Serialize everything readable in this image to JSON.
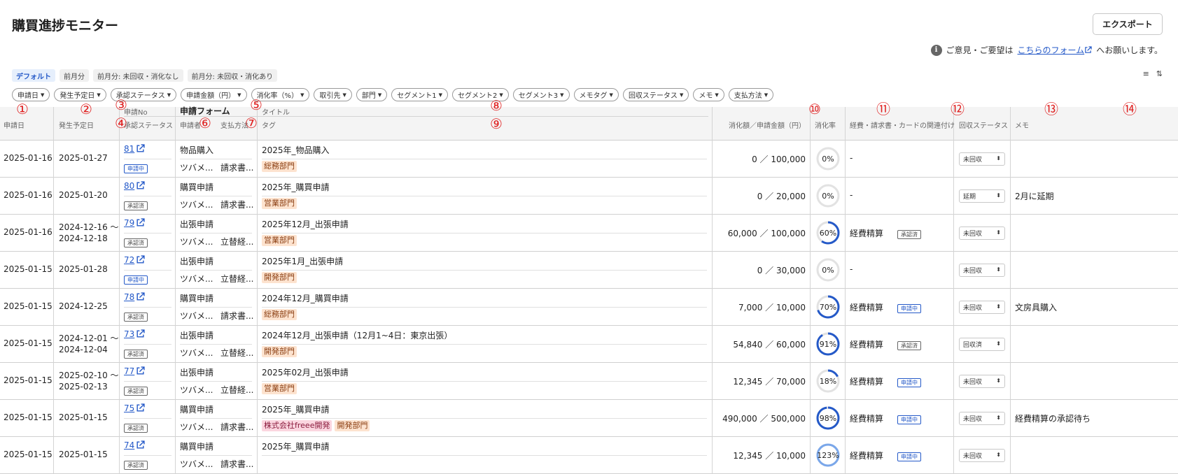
{
  "header": {
    "title": "購買進捗モニター",
    "export_label": "エクスポート",
    "feedback_prefix": "ご意見・ご要望は",
    "feedback_link": "こちらのフォーム",
    "feedback_suffix": "へお願いします。"
  },
  "presets": [
    "デフォルト",
    "前月分",
    "前月分: 未回収・消化なし",
    "前月分: 未回収・消化あり"
  ],
  "filters": [
    "申請日",
    "発生予定日",
    "承認ステータス",
    "申請金額（円）",
    "消化率（%）",
    "取引先",
    "部門",
    "セグメント1",
    "セグメント2",
    "セグメント3",
    "メモタグ",
    "回収ステータス",
    "メモ",
    "支払方法"
  ],
  "columns": {
    "apply_date": "申請日",
    "occur_date": "発生予定日",
    "apply_no": "申請No",
    "approval_status": "承認ステータス",
    "form": "申請フォーム",
    "applicant": "申請者",
    "payment_method": "支払方法",
    "title": "タイトル",
    "tags": "タグ",
    "amount": "消化額／申請金額（円）",
    "rate": "消化率",
    "linked": "経費・請求書・カードの関連付け",
    "collect_status": "回収ステータス",
    "memo": "メモ"
  },
  "markers": [
    "①",
    "②",
    "③",
    "④",
    "⑤",
    "⑥",
    "⑦",
    "⑧",
    "⑨",
    "⑩",
    "⑪",
    "⑫",
    "⑬",
    "⑭"
  ],
  "colors": {
    "accent": "#2459c8",
    "marker": "#e02020",
    "ring_track": "#e2e2e2"
  },
  "rows": [
    {
      "apply_date": "2025-01-16",
      "occur_date_1": "2025-01-27",
      "occur_date_2": "",
      "no": "81",
      "status": "申請中",
      "form": "物品購入",
      "applicant": "ツバメ...",
      "payment": "請求書...",
      "title": "2025年_物品購入",
      "tags": [
        {
          "text": "総務部門",
          "color": "orange"
        }
      ],
      "amount": "0 ／ 100,000",
      "rate": 0,
      "rate_label": "0%",
      "linked": "-",
      "linked_badge": "",
      "collect": "未回収",
      "memo": ""
    },
    {
      "apply_date": "2025-01-16",
      "occur_date_1": "2025-01-20",
      "occur_date_2": "",
      "no": "80",
      "status": "承認済",
      "form": "購買申請",
      "applicant": "ツバメ...",
      "payment": "請求書...",
      "title": "2025年_購買申請",
      "tags": [
        {
          "text": "営業部門",
          "color": "orange"
        }
      ],
      "amount": "0 ／ 20,000",
      "rate": 0,
      "rate_label": "0%",
      "linked": "-",
      "linked_badge": "",
      "collect": "延期",
      "memo": "2月に延期"
    },
    {
      "apply_date": "2025-01-16",
      "occur_date_1": "2024-12-16 ～",
      "occur_date_2": "2024-12-18",
      "no": "79",
      "status": "承認済",
      "form": "出張申請",
      "applicant": "ツバメ...",
      "payment": "立替経...",
      "title": "2025年12月_出張申請",
      "tags": [
        {
          "text": "営業部門",
          "color": "orange"
        }
      ],
      "amount": "60,000 ／ 100,000",
      "rate": 60,
      "rate_label": "60%",
      "linked": "経費精算",
      "linked_badge": "承認済",
      "collect": "未回収",
      "memo": ""
    },
    {
      "apply_date": "2025-01-15",
      "occur_date_1": "2025-01-28",
      "occur_date_2": "",
      "no": "72",
      "status": "申請中",
      "form": "出張申請",
      "applicant": "ツバメ...",
      "payment": "立替経...",
      "title": "2025年1月_出張申請",
      "tags": [
        {
          "text": "開発部門",
          "color": "orange"
        }
      ],
      "amount": "0 ／ 30,000",
      "rate": 0,
      "rate_label": "0%",
      "linked": "-",
      "linked_badge": "",
      "collect": "未回収",
      "memo": ""
    },
    {
      "apply_date": "2025-01-15",
      "occur_date_1": "2024-12-25",
      "occur_date_2": "",
      "no": "78",
      "status": "承認済",
      "form": "購買申請",
      "applicant": "ツバメ...",
      "payment": "請求書...",
      "title": "2024年12月_購買申請",
      "tags": [
        {
          "text": "総務部門",
          "color": "orange"
        }
      ],
      "amount": "7,000 ／ 10,000",
      "rate": 70,
      "rate_label": "70%",
      "linked": "経費精算",
      "linked_badge": "申請中",
      "collect": "未回収",
      "memo": "文房具購入"
    },
    {
      "apply_date": "2025-01-15",
      "occur_date_1": "2024-12-01 ～",
      "occur_date_2": "2024-12-04",
      "no": "73",
      "status": "承認済",
      "form": "出張申請",
      "applicant": "ツバメ...",
      "payment": "立替経...",
      "title": "2024年12月_出張申請（12月1~4日：東京出張）",
      "tags": [
        {
          "text": "開発部門",
          "color": "orange"
        }
      ],
      "amount": "54,840 ／ 60,000",
      "rate": 91,
      "rate_label": "91%",
      "linked": "経費精算",
      "linked_badge": "承認済",
      "collect": "回収済",
      "memo": ""
    },
    {
      "apply_date": "2025-01-15",
      "occur_date_1": "2025-02-10 ～",
      "occur_date_2": "2025-02-13",
      "no": "77",
      "status": "承認済",
      "form": "出張申請",
      "applicant": "ツバメ...",
      "payment": "立替経...",
      "title": "2025年02月_出張申請",
      "tags": [
        {
          "text": "営業部門",
          "color": "orange"
        }
      ],
      "amount": "12,345 ／ 70,000",
      "rate": 18,
      "rate_label": "18%",
      "linked": "経費精算",
      "linked_badge": "申請中",
      "collect": "未回収",
      "memo": ""
    },
    {
      "apply_date": "2025-01-15",
      "occur_date_1": "2025-01-15",
      "occur_date_2": "",
      "no": "75",
      "status": "承認済",
      "form": "購買申請",
      "applicant": "ツバメ...",
      "payment": "請求書...",
      "title": "2025年_購買申請",
      "tags": [
        {
          "text": "株式会社freee開発",
          "color": "pink"
        },
        {
          "text": "開発部門",
          "color": "orange"
        }
      ],
      "amount": "490,000 ／ 500,000",
      "rate": 98,
      "rate_label": "98%",
      "linked": "経費精算",
      "linked_badge": "申請中",
      "collect": "未回収",
      "memo": "経費精算の承認待ち"
    },
    {
      "apply_date": "2025-01-15",
      "occur_date_1": "2025-01-15",
      "occur_date_2": "",
      "no": "74",
      "status": "承認済",
      "form": "購買申請",
      "applicant": "ツバメ...",
      "payment": "請求書...",
      "title": "2025年_購買申請",
      "tags": [],
      "amount": "12,345 ／ 10,000",
      "rate": 123,
      "rate_label": "123%",
      "linked": "経費精算",
      "linked_badge": "申請中",
      "collect": "未回収",
      "memo": ""
    }
  ]
}
